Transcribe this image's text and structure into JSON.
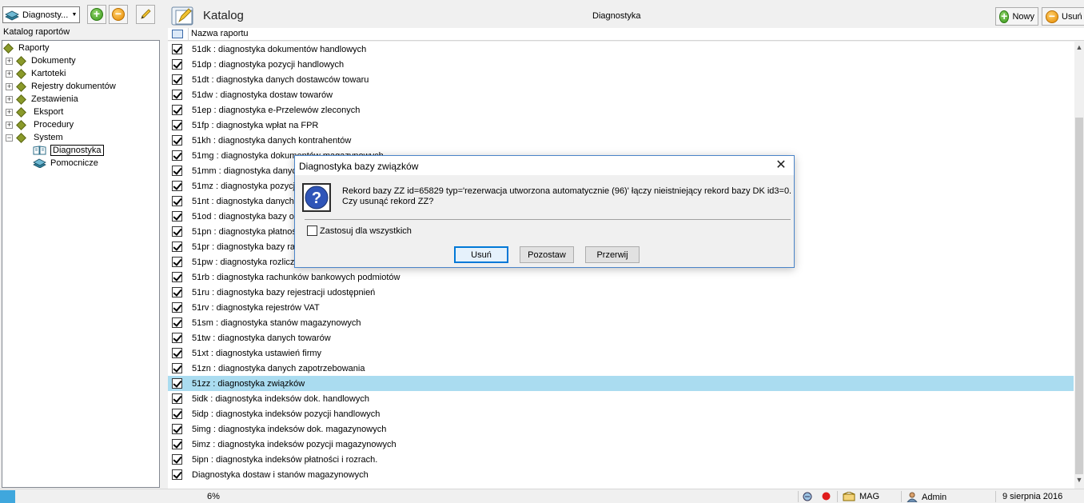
{
  "left": {
    "combo_value": "Diagnosty...",
    "title": "Katalog raportów",
    "tree": {
      "root": "Raporty",
      "nodes": [
        "Dokumenty",
        "Kartoteki",
        "Rejestry dokumentów",
        "Zestawienia",
        "Eksport",
        "Procedury",
        "System"
      ],
      "system_children": [
        "Diagnostyka",
        "Pomocnicze"
      ]
    }
  },
  "header": {
    "title": "Katalog",
    "center": "Diagnostyka",
    "new_label": "Nowy",
    "delete_label": "Usuń"
  },
  "grid": {
    "column_header": "Nazwa raportu",
    "rows": [
      "51dk : diagnostyka dokumentów handlowych",
      "51dp : diagnostyka pozycji handlowych",
      "51dt : diagnostyka danych dostawców towaru",
      "51dw : diagnostyka dostaw towarów",
      "51ep : diagnostyka e-Przelewów zleconych",
      "51fp : diagnostyka wpłat na FPR",
      "51kh : diagnostyka danych kontrahentów",
      "51mg : diagnostyka dokumentów magazynowych",
      "51mm : diagnostyka danych",
      "51mz : diagnostyka pozycji",
      "51nt : diagnostyka danych",
      "51od : diagnostyka bazy och",
      "51pn : diagnostyka płatności",
      "51pr : diagnostyka bazy rapo",
      "51pw : diagnostyka rozliczeń",
      "51rb : diagnostyka rachunków bankowych podmiotów",
      "51ru : diagnostyka bazy rejestracji udostępnień",
      "51rv : diagnostyka rejestrów VAT",
      "51sm : diagnostyka stanów magazynowych",
      "51tw : diagnostyka danych towarów",
      "51xt : diagnostyka ustawień firmy",
      "51zn : diagnostyka danych zapotrzebowania",
      "51zz : diagnostyka związków",
      "5idk : diagnostyka indeksów dok. handlowych",
      "5idp : diagnostyka indeksów pozycji handlowych",
      "5img : diagnostyka indeksów dok. magazynowych",
      "5imz : diagnostyka indeksów pozycji magazynowych",
      "5ipn : diagnostyka indeksów płatności i rozrach.",
      "Diagnostyka dostaw i stanów magazynowych"
    ],
    "selected_index": 22
  },
  "status": {
    "progress": "6%",
    "progress_fraction": 0.06,
    "warehouse": "MAG",
    "user": "Admin",
    "date": "9 sierpnia 2016"
  },
  "dialog": {
    "title": "Diagnostyka bazy związków",
    "message_line1": "Rekord bazy ZZ id=65829 typ='rezerwacja utworzona automatycznie (96)' łączy nieistniejący rekord bazy DK id3=0.",
    "message_line2": "Czy usunąć rekord ZZ?",
    "checkbox_label": "Zastosuj dla wszystkich",
    "btn_delete": "Usuń",
    "btn_keep": "Pozostaw",
    "btn_abort": "Przerwij"
  },
  "colors": {
    "selection": "#aadcf0",
    "progress": "#3fa7dd",
    "dialog_border": "#4a84c8"
  }
}
